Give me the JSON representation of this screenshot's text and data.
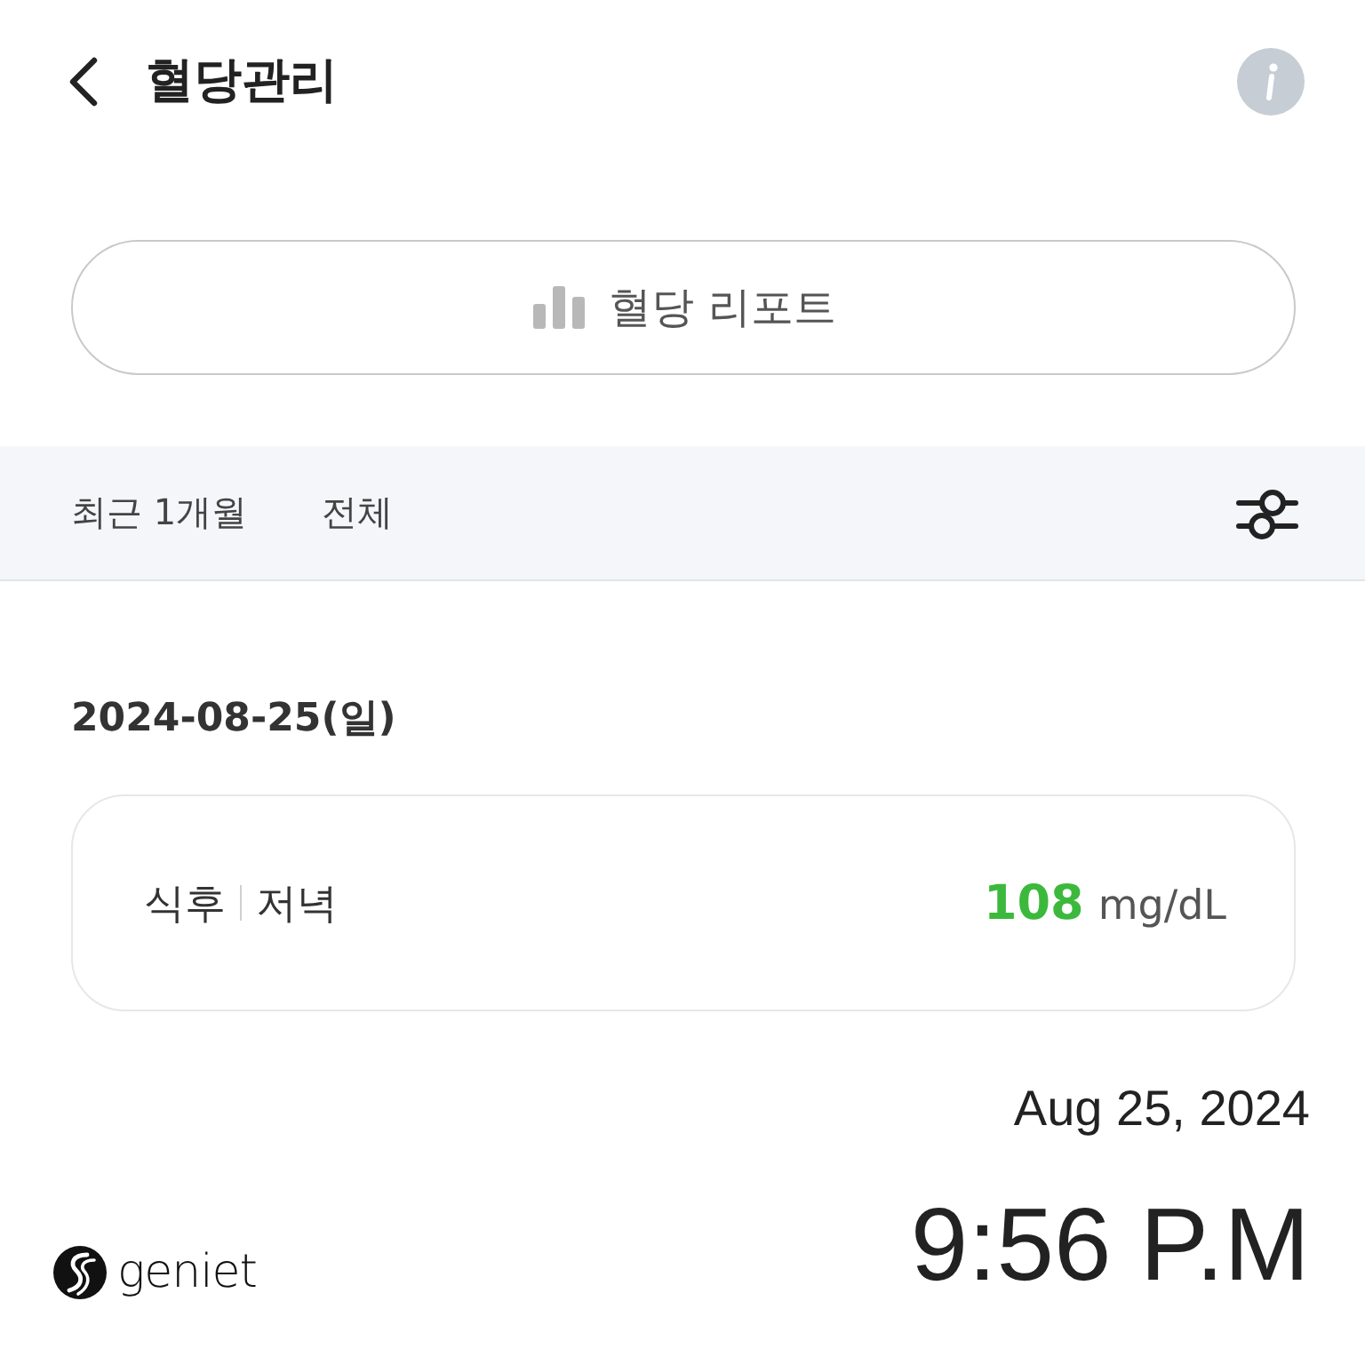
{
  "header": {
    "title": "혈당관리"
  },
  "report_button": {
    "label": "혈당 리포트"
  },
  "filter_bar": {
    "period": "최근 1개월",
    "category": "전체"
  },
  "days": [
    {
      "date": "2024-08-25(일)",
      "entries": [
        {
          "timing": "식후",
          "meal": "저녁",
          "value": "108",
          "unit": "mg/dL",
          "color": "#3cb93c"
        }
      ]
    }
  ],
  "stamp": {
    "date": "Aug 25, 2024",
    "time": "9:56 P.M",
    "brand": "geniet"
  }
}
